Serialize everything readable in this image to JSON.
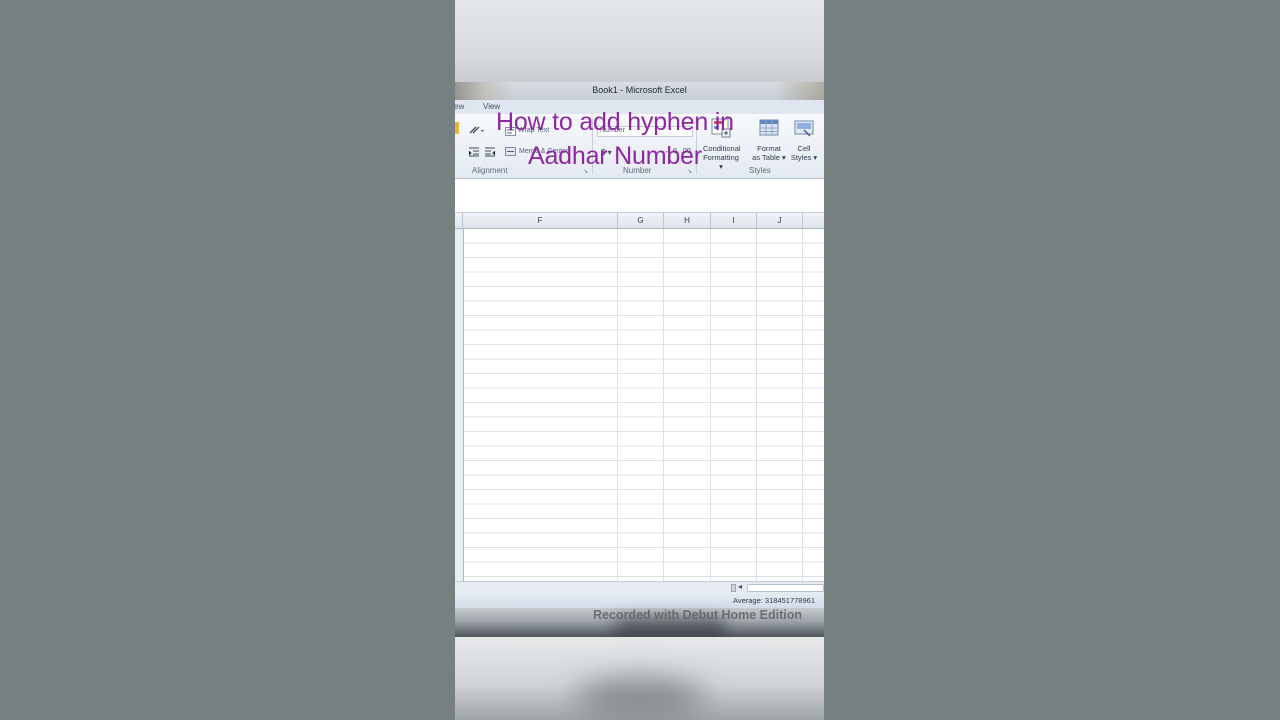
{
  "window": {
    "title": "Book1  -  Microsoft Excel"
  },
  "ribbon_tabs": [
    "ew",
    "View"
  ],
  "ribbon": {
    "alignment": {
      "label": "Alignment",
      "wrap_text": "Wrap Text",
      "merge_center": "Merge & Center"
    },
    "number": {
      "label": "Number",
      "format_value": "Number"
    },
    "styles": {
      "label": "Styles",
      "conditional_formatting": [
        "Conditional",
        "Formatting"
      ],
      "format_as_table": [
        "Format",
        "as Table"
      ],
      "cell_styles": [
        "Cell",
        "Styles"
      ]
    }
  },
  "columns": [
    "F",
    "G",
    "H",
    "I",
    "J"
  ],
  "status": {
    "average": "Average: 318451778961"
  },
  "overlay": {
    "line1": "How to add hyphen in",
    "line2": "Aadhar Number"
  },
  "watermark": "Recorded with Debut Home Edition",
  "colors": {
    "overlay_text": "#8f28a0",
    "background": "#768081"
  }
}
